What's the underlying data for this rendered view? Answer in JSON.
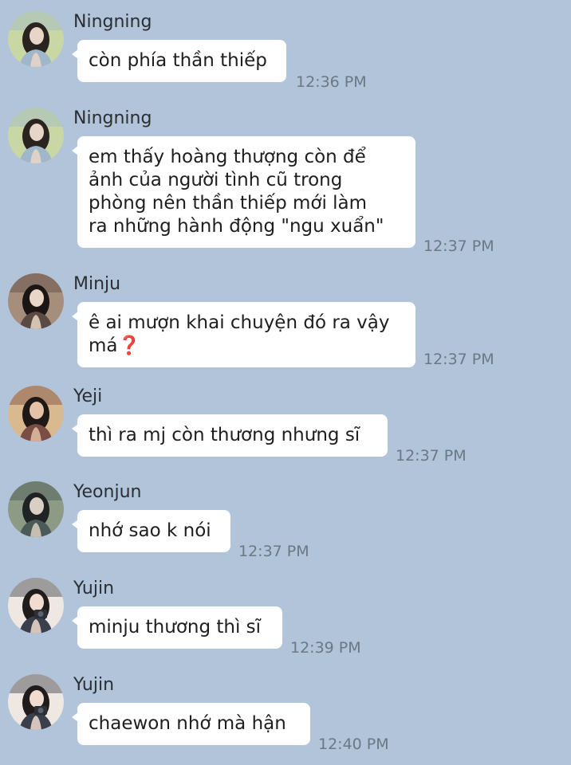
{
  "messages": [
    {
      "sender": "Ningning",
      "lines": [
        "còn phía thần thiếp"
      ],
      "time": "12:36 PM",
      "avatar_icon": "girl-portrait-avatar",
      "avatar_colors": [
        "#c9d7a4",
        "#2a2421",
        "#e7d6c8",
        "#9fb7c8"
      ]
    },
    {
      "sender": "Ningning",
      "lines": [
        "em thấy hoàng thượng còn để",
        "ảnh của người tình cũ trong",
        "phòng nên thần thiếp mới làm",
        "ra những hành động \"ngu xuẩn\""
      ],
      "time": "12:37 PM",
      "avatar_icon": "girl-portrait-avatar",
      "avatar_colors": [
        "#c9d7a4",
        "#2a2421",
        "#e7d6c8",
        "#9fb7c8"
      ]
    },
    {
      "sender": "Minju",
      "lines": [
        "ê ai mượn khai chuyện đó ra vậy",
        "má"
      ],
      "emoji": "❓",
      "time": "12:37 PM",
      "avatar_icon": "girl-portrait-avatar",
      "avatar_colors": [
        "#a68e7c",
        "#1b1614",
        "#e9d6c6",
        "#5a4a42"
      ]
    },
    {
      "sender": "Yeji",
      "lines": [
        "thì ra mj còn thương nhưng sĩ"
      ],
      "time": "12:37 PM",
      "avatar_icon": "girl-portrait-avatar",
      "avatar_colors": [
        "#d9b98f",
        "#1e1816",
        "#e4c1a7",
        "#7a4e44"
      ]
    },
    {
      "sender": "Yeonjun",
      "lines": [
        "nhớ sao k nói"
      ],
      "time": "12:37 PM",
      "avatar_icon": "person-photo-avatar",
      "avatar_colors": [
        "#8d9a86",
        "#1f2324",
        "#d9d0c3",
        "#4b5a57"
      ]
    },
    {
      "sender": "Yujin",
      "lines": [
        "minju thương thì sĩ"
      ],
      "time": "12:39 PM",
      "avatar_icon": "girl-camera-avatar",
      "avatar_colors": [
        "#efe7e1",
        "#201c1b",
        "#f1dccf",
        "#3b3f4c"
      ]
    },
    {
      "sender": "Yujin",
      "lines": [
        "chaewon nhớ mà hận"
      ],
      "time": "12:40 PM",
      "avatar_icon": "girl-camera-avatar",
      "avatar_colors": [
        "#efe7e1",
        "#201c1b",
        "#f1dccf",
        "#3b3f4c"
      ]
    }
  ]
}
